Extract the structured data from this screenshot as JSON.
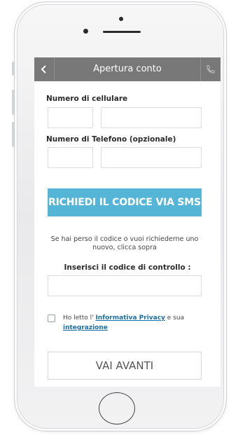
{
  "nav": {
    "title": "Apertura conto",
    "back_icon": "chevron-left-icon",
    "phone_icon": "phone-icon"
  },
  "form": {
    "mobile_label": "Numero di cellulare",
    "phone_label": "Numero di Telefono (opzionale)",
    "sms_button_label": "RICHIEDI IL CODICE VIA SMS",
    "hint_text": "Se hai perso il codice o vuoi richiederne uno nuovo, clicca sopra",
    "code_label": "Inserisci il codice di controllo :",
    "privacy_prefix": "Ho letto l'",
    "privacy_link": "Informativa Privacy",
    "privacy_middle": "e sua",
    "integration_link": "integrazione",
    "next_button_label": "VAI AVANTI"
  },
  "colors": {
    "navbar": "#787878",
    "sms_button": "#55b5d6",
    "link": "#1a6ea3"
  }
}
